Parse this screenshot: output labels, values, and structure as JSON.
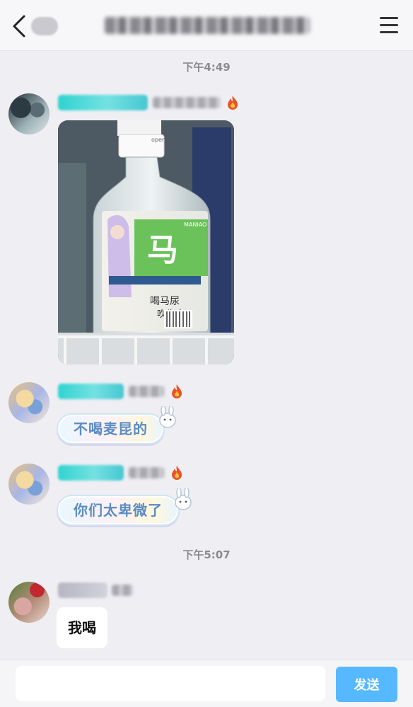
{
  "messages": [
    {
      "time": "下午4:49"
    },
    {
      "text": "不喝麦昆的"
    },
    {
      "text": "你们太卑微了"
    },
    {
      "time": "下午5:07"
    },
    {
      "text": "我喝"
    }
  ],
  "input": {
    "placeholder": "",
    "send_label": "发送"
  },
  "colors": {
    "accent": "#56b8ff",
    "name_tag": "#2fd3d0",
    "background": "#efeef3"
  },
  "icons": [
    "back-icon",
    "menu-icon",
    "fire-icon",
    "bunny-icon"
  ]
}
